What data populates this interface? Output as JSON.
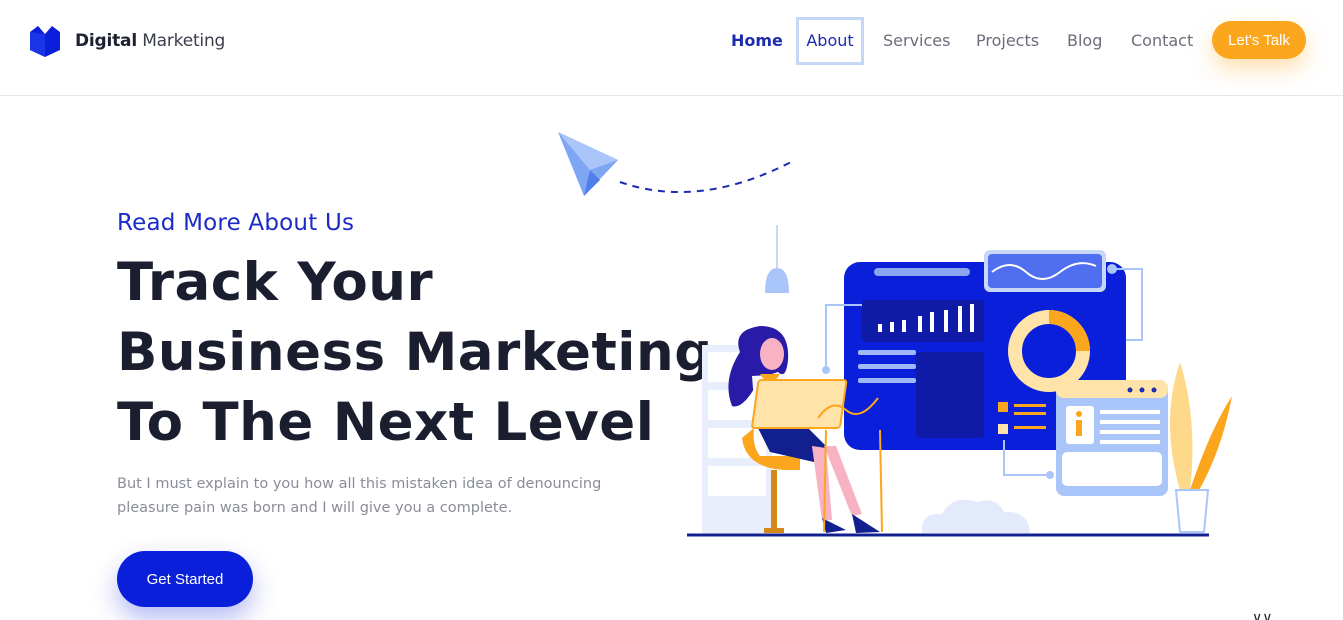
{
  "brand": {
    "name_bold": "Digital",
    "name_light": "Marketing"
  },
  "nav": {
    "home": "Home",
    "about": "About",
    "services": "Services",
    "projects": "Projects",
    "blog": "Blog",
    "contact": "Contact",
    "cta": "Let's Talk"
  },
  "hero": {
    "eyebrow": "Read More About Us",
    "title_lines": [
      "Track Your",
      "Business Marketing",
      "To The Next Level"
    ],
    "description": "But I must explain to you how all this mistaken idea of denouncing pleasure pain was born and I will give you a complete.",
    "button": "Get Started"
  },
  "colors": {
    "accent_blue": "#0a1fd9",
    "nav_active": "#1d2cae",
    "accent_orange": "#fba61c",
    "heading": "#1b1e2e",
    "muted_text": "#8a8d98"
  },
  "icons": [
    "logo-mark-icon",
    "paper-plane-icon",
    "scroll-down-icon"
  ]
}
